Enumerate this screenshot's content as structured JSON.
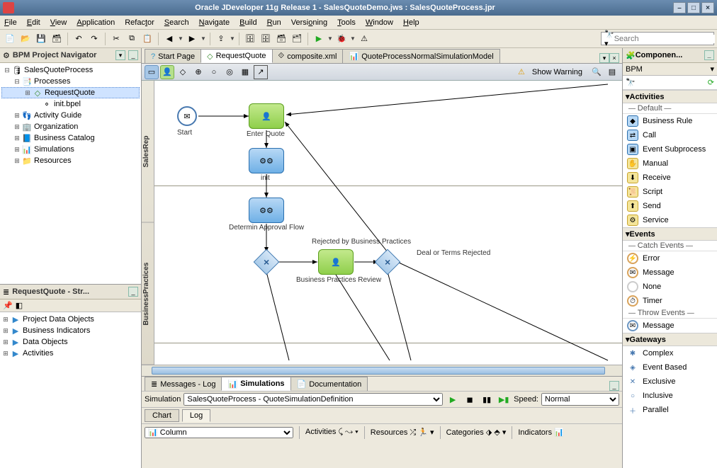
{
  "titlebar": {
    "text": "Oracle JDeveloper 11g Release 1 - SalesQuoteDemo.jws : SalesQuoteProcess.jpr"
  },
  "menu": [
    "File",
    "Edit",
    "View",
    "Application",
    "Refactor",
    "Search",
    "Navigate",
    "Build",
    "Run",
    "Versioning",
    "Tools",
    "Window",
    "Help"
  ],
  "search": {
    "placeholder": "Search"
  },
  "left": {
    "navigator_title": "BPM Project Navigator",
    "tree": {
      "root": "SalesQuoteProcess",
      "processes": {
        "label": "Processes",
        "items": [
          "RequestQuote",
          "init.bpel"
        ]
      },
      "others": [
        "Activity Guide",
        "Organization",
        "Business Catalog",
        "Simulations",
        "Resources"
      ]
    },
    "structure_title": "RequestQuote - Str...",
    "structure_items": [
      "Project Data Objects",
      "Business Indicators",
      "Data Objects",
      "Activities"
    ]
  },
  "tabs": [
    {
      "label": "Start Page",
      "icon": "q"
    },
    {
      "label": "RequestQuote",
      "icon": "bp",
      "active": true
    },
    {
      "label": "composite.xml",
      "icon": "xml"
    },
    {
      "label": "QuoteProcessNormalSimulationModel",
      "icon": "sim"
    }
  ],
  "editor": {
    "warning": "Show Warning",
    "lanes": [
      "SalesRep",
      "BusinessPractices"
    ],
    "nodes": {
      "start": {
        "label": "Start"
      },
      "enter": {
        "label": "Enter Quote"
      },
      "init": {
        "label": "init"
      },
      "detflow": {
        "label": "Determin Approval Flow"
      },
      "bpr": {
        "label": "Business Practices Review"
      }
    },
    "edges": {
      "rejected": "Rejected by Business Practices",
      "deal": "Deal or Terms Rejected"
    }
  },
  "bottom": {
    "tabs": [
      "Messages - Log",
      "Simulations",
      "Documentation"
    ],
    "active_tab": 1,
    "sim_label": "Simulation",
    "sim_value": "SalesQuoteProcess - QuoteSimulationDefinition",
    "speed_label": "Speed:",
    "speed_value": "Normal",
    "view_tabs": [
      "Chart",
      "Log"
    ],
    "active_view": 1,
    "column_value": "Column",
    "groups": [
      "Activities",
      "Resources",
      "Categories",
      "Indicators"
    ]
  },
  "palette": {
    "title": "Componen...",
    "sub": "BPM",
    "sections": {
      "activities": {
        "title": "Activities",
        "sub": "Default",
        "items": [
          "Business Rule",
          "Call",
          "Event Subprocess",
          "Manual",
          "Receive",
          "Script",
          "Send",
          "Service"
        ]
      },
      "events": {
        "title": "Events",
        "sub": "Catch Events",
        "items": [
          "Error",
          "Message",
          "None",
          "Timer"
        ],
        "throw_sub": "Throw Events",
        "throw_items": [
          "Message"
        ]
      },
      "gateways": {
        "title": "Gateways",
        "items": [
          "Complex",
          "Event Based",
          "Exclusive",
          "Inclusive",
          "Parallel"
        ]
      }
    }
  }
}
